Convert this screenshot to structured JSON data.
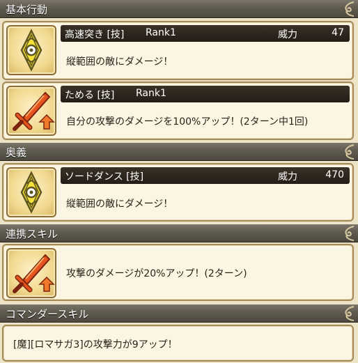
{
  "sections": {
    "basic": {
      "title": "基本行動"
    },
    "ougi": {
      "title": "奥義"
    },
    "renkei": {
      "title": "連携スキル"
    },
    "commander": {
      "title": "コマンダースキル"
    }
  },
  "skills": {
    "s1": {
      "name": "高速突き [技]",
      "rank": "Rank1",
      "power_label": "威力",
      "power": "47",
      "desc": "縦範囲の敵にダメージ！",
      "icon": "sword-technique-icon"
    },
    "s2": {
      "name": "ためる [技]",
      "rank": "Rank1",
      "desc": "自分の攻撃のダメージを100%アップ！(2ターン中1回)",
      "icon": "flame-sword-up-icon"
    },
    "s3": {
      "name": "ソードダンス [技]",
      "power_label": "威力",
      "power": "470",
      "desc": "縦範囲の敵にダメージ！",
      "icon": "sword-technique-icon"
    },
    "s4": {
      "desc": "攻撃のダメージが20%アップ！(2ターン)",
      "icon": "flame-sword-up-icon"
    }
  },
  "commander": {
    "desc": "[魔][ロマサガ3]の攻撃力が9アップ！"
  },
  "colors": {
    "header": "#5f5a4e",
    "card_bg": "#fbf6e3",
    "card_border": "#a48a58",
    "name_bar": "#2b241b",
    "flame": "#e5541f"
  }
}
